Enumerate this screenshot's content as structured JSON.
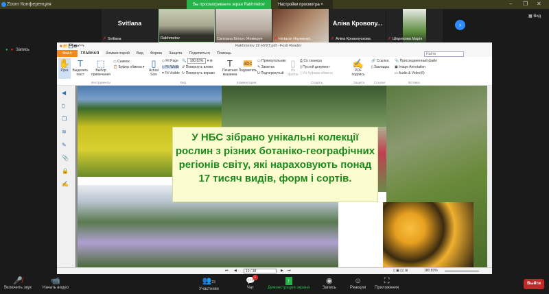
{
  "window": {
    "title": "Zoom Конференция",
    "share_banner": "Вы просматриваете экран Rakhmetov",
    "view_settings": "Настройки просмотра ˅",
    "view_button": "Вид",
    "record_label": "Запись"
  },
  "participants": [
    {
      "display": "Svitlana",
      "name": "Svitlana",
      "muted": true
    },
    {
      "display": "",
      "name": "Rakhmetov",
      "muted": false
    },
    {
      "display": "",
      "name": "Світлана Білоус-Жемерун",
      "muted": false
    },
    {
      "display": "",
      "name": "Наталія Науменко",
      "muted": true
    },
    {
      "display": "Аліна Кровопу...",
      "name": "Аліна Кровопускова",
      "muted": true
    },
    {
      "display": "",
      "name": "Шорнікова Марія",
      "muted": true
    }
  ],
  "foxit": {
    "title": "Rakhmetov 22 НУХТ.pdf - Foxit Reader",
    "tabs": [
      "Файл",
      "ГЛАВНАЯ",
      "Комментарий",
      "Вид",
      "Форма",
      "Защита",
      "Поделиться",
      "Помощь"
    ],
    "search_placeholder": "Найти",
    "ribbon": {
      "hand": "Рука",
      "select_text": "Выделить текст",
      "select_annot": "Выбор примечания",
      "snapshot": "Снимок",
      "clipboard": "Буфер обмена",
      "tools_group": "Инструменты",
      "actual_size": "Actual Size",
      "fit_page": "Fit Page",
      "fit_width": "Fit Width",
      "fit_visible": "Fit Visible",
      "zoom_value": "180.83%",
      "rotate_left": "Повернуть влево",
      "rotate_right": "Повернуть вправо",
      "view_group": "Вид",
      "typewriter": "Печатная машинка",
      "highlight": "Подсветить",
      "rectangle": "Прямоугольник",
      "note": "Заметка",
      "underline": "Подчеркнутый",
      "comments_group": "Комментарии",
      "from_file": "Из файла",
      "from_scanner": "Со сканера",
      "blank": "Пустой документ",
      "from_clipboard": "Из буфера обмена",
      "create_group": "Создать",
      "pdf_sign": "PDF подпись",
      "protect_group": "Защита",
      "link": "Ссылка",
      "bookmark": "Закладка",
      "links_group": "Ссылки",
      "attach_file": "Присоединенный файл",
      "image_annot": "Image Annotation",
      "audio_video": "Audio & Video(б)",
      "insert_group": "Вставка"
    },
    "slide_text": "У НБС зібрано унікальні колекції рослин з різних ботаніко-географічних регіонів світу, які нараховують понад 17 тисяч видів, форм і сортів.",
    "page": "10 / 38",
    "zoom": "180.83%"
  },
  "toolbar": {
    "unmute": "Включить звук",
    "start_video": "Начать видео",
    "participants": "Участники",
    "participants_count": "23",
    "chat": "Чат",
    "chat_badge": "1",
    "share": "Демонстрация экрана",
    "record": "Запись",
    "reactions": "Реакции",
    "apps": "Приложения",
    "leave": "Выйти"
  },
  "colors": {
    "share_green": "#27b34a",
    "slide_text": "#1d8a1d",
    "leave_red": "#c0282a",
    "zoom_blue": "#2d8cff"
  }
}
